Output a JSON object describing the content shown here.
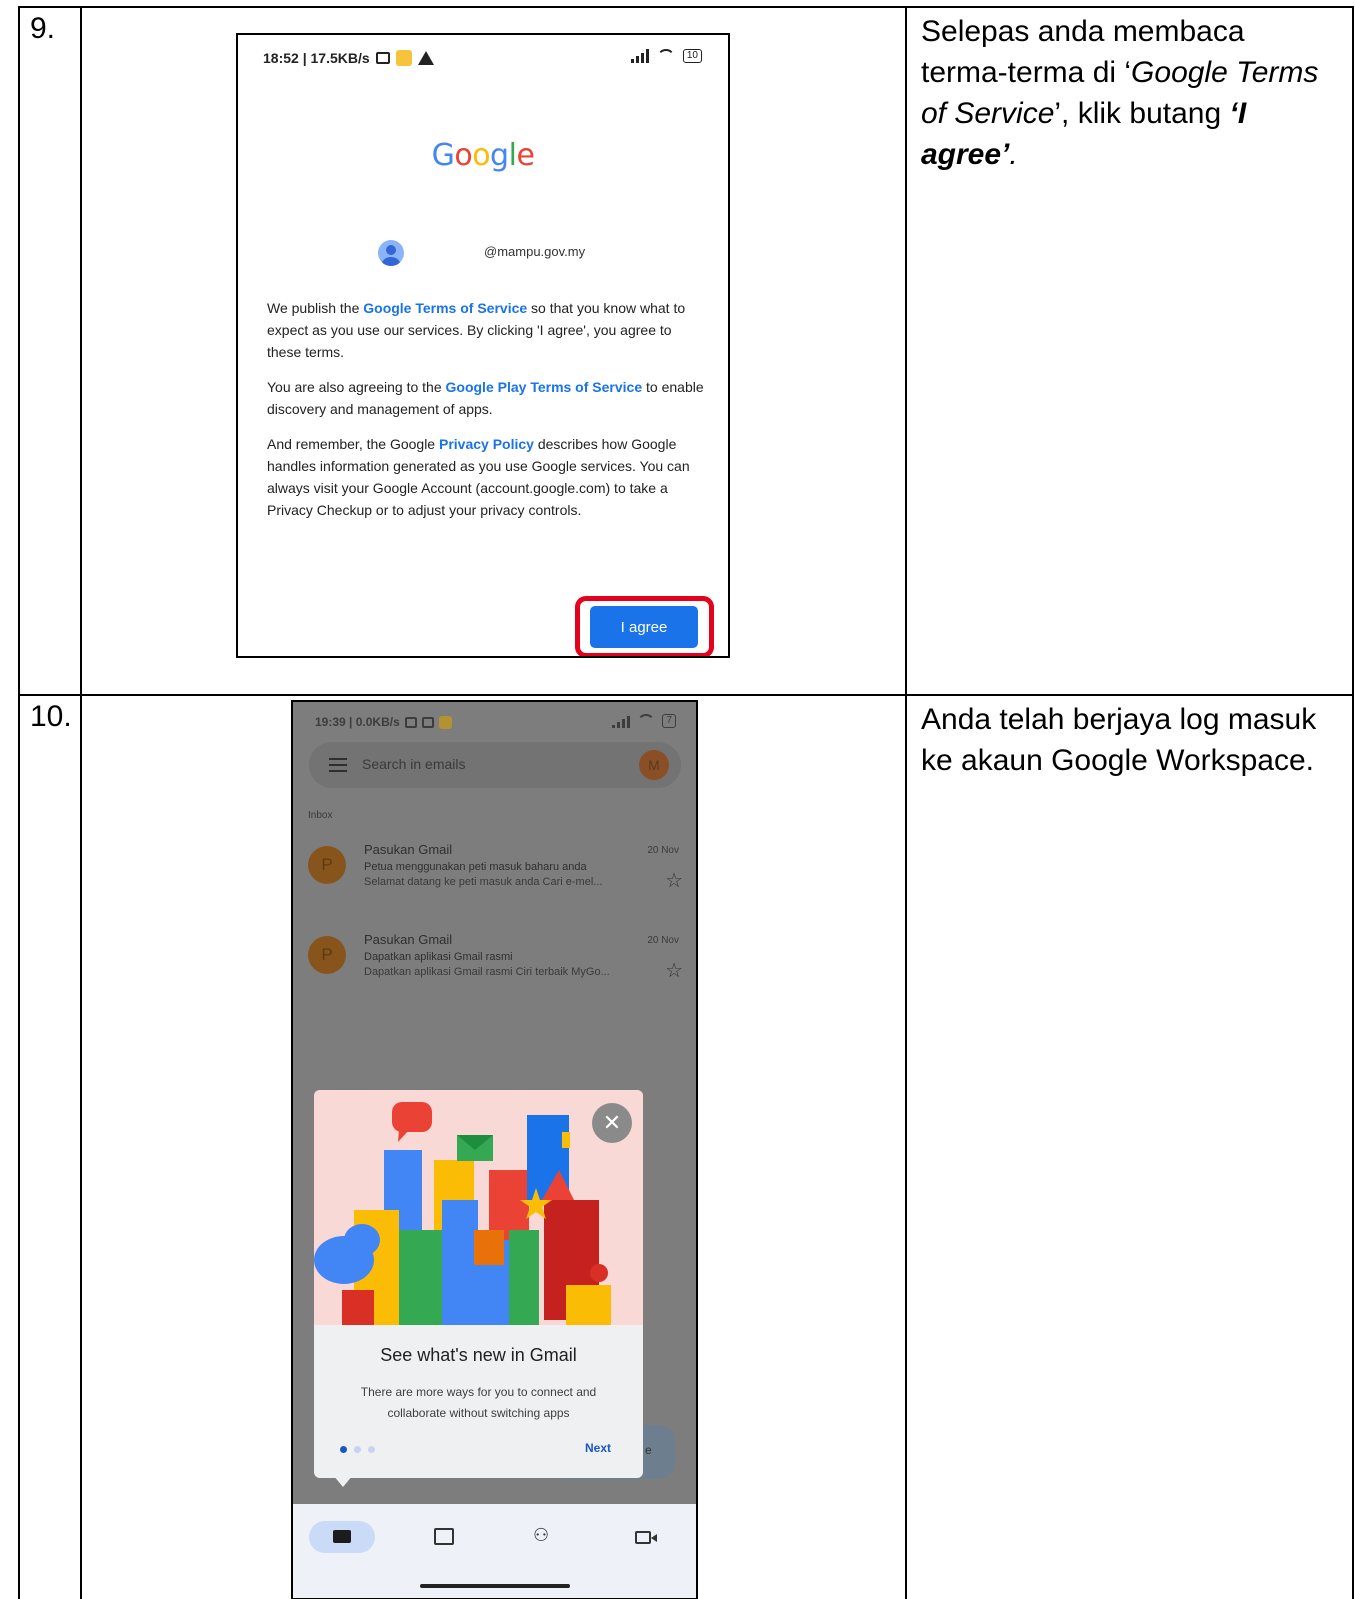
{
  "rows": [
    {
      "number": "9.",
      "description_parts": [
        "Selepas anda membaca terma-terma di ‘",
        "Google Terms of Service",
        "’, klik butang ",
        "‘I agree’",
        "."
      ],
      "screen": {
        "status_left": "18:52 | 17.5KB/s",
        "battery": "10",
        "logo_letters": [
          "G",
          "o",
          "o",
          "g",
          "l",
          "e"
        ],
        "account_email": "@mampu.gov.my",
        "paragraphs": [
          {
            "before": "We publish the ",
            "link": "Google Terms of Service",
            "after": " so that you know what to expect as you use our services. By clicking 'I agree', you agree to these terms."
          },
          {
            "before": "You are also agreeing to the ",
            "link": "Google Play Terms of Service",
            "after": " to enable discovery and management of apps."
          },
          {
            "before": "And remember, the Google ",
            "link": "Privacy Policy",
            "after": " describes how Google handles information generated as you use Google services. You can always visit your Google Account (account.google.com) to take a Privacy Checkup or to adjust your privacy controls."
          }
        ],
        "agree_button": "I agree",
        "highlight_color": "#e5001b"
      }
    },
    {
      "number": "10.",
      "description": "Anda telah berjaya log masuk ke akaun Google Workspace.",
      "screen": {
        "status_left": "19:39 | 0.0KB/s",
        "battery": "7",
        "search_placeholder": "Search in emails",
        "account_initial": "M",
        "inbox_label": "Inbox",
        "emails": [
          {
            "initial": "P",
            "from": "Pasukan Gmail",
            "date": "20 Nov",
            "subject": "Petua menggunakan peti masuk baharu anda",
            "snippet": "Selamat datang ke peti masuk anda Cari e-mel..."
          },
          {
            "initial": "P",
            "from": "Pasukan Gmail",
            "date": "20 Nov",
            "subject": "Dapatkan aplikasi Gmail rasmi",
            "snippet": "Dapatkan aplikasi Gmail rasmi Ciri terbaik MyGo..."
          }
        ],
        "compose_peek": "e",
        "modal": {
          "title": "See what's new in Gmail",
          "body": "There are more ways for you to connect and collaborate without switching apps",
          "next": "Next",
          "close_glyph": "✕"
        },
        "nav_icons": [
          "mail-icon",
          "chat-icon",
          "spaces-icon",
          "meet-icon"
        ]
      }
    }
  ]
}
